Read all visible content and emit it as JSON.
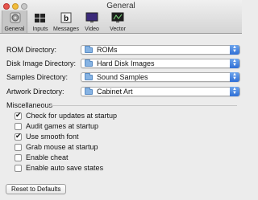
{
  "window": {
    "title": "General"
  },
  "toolbar": {
    "items": [
      {
        "label": "General",
        "icon": "gear-icon",
        "selected": true
      },
      {
        "label": "Inputs",
        "icon": "keyboard-icon",
        "selected": false
      },
      {
        "label": "Messages",
        "icon": "book-icon",
        "selected": false
      },
      {
        "label": "Video",
        "icon": "monitor-icon",
        "selected": false
      },
      {
        "label": "Vector",
        "icon": "vector-monitor-icon",
        "selected": false
      }
    ]
  },
  "directories": {
    "rom": {
      "label": "ROM Directory:",
      "value": "ROMs"
    },
    "disk": {
      "label": "Disk Image Directory:",
      "value": "Hard Disk Images"
    },
    "samples": {
      "label": "Samples Directory:",
      "value": "Sound Samples"
    },
    "artwork": {
      "label": "Artwork Directory:",
      "value": "Cabinet Art"
    }
  },
  "misc": {
    "title": "Miscellaneous",
    "options": [
      {
        "label": "Check for updates at startup",
        "checked": true
      },
      {
        "label": "Audit games at startup",
        "checked": false
      },
      {
        "label": "Use smooth font",
        "checked": true
      },
      {
        "label": "Grab mouse at startup",
        "checked": false
      },
      {
        "label": "Enable cheat",
        "checked": false
      },
      {
        "label": "Enable auto save states",
        "checked": false
      }
    ]
  },
  "buttons": {
    "reset": "Reset to Defaults"
  },
  "colors": {
    "accent": "#2f6fd6",
    "background": "#ececec",
    "close": "#e6564d",
    "minimize": "#f2bd3a"
  }
}
